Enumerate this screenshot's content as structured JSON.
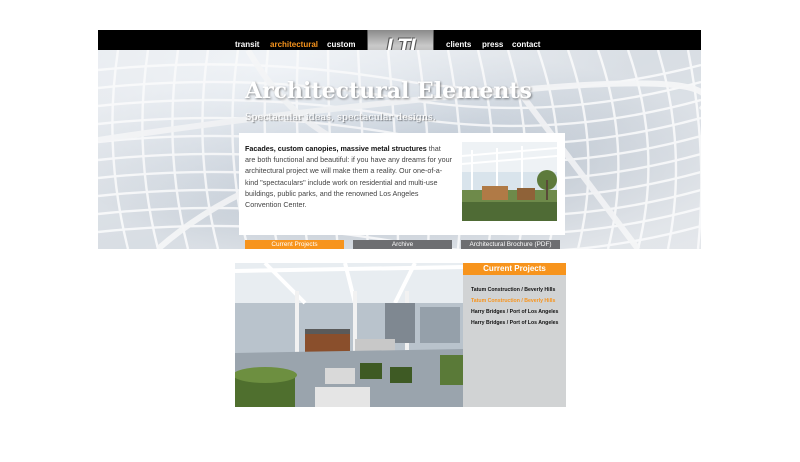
{
  "nav": {
    "left": [
      "transit",
      "architectural",
      "custom"
    ],
    "right": [
      "clients",
      "press",
      "contact"
    ],
    "active": "architectural",
    "logo_text": "LTI"
  },
  "hero": {
    "title": "Architectural Elements",
    "subtitle": "Spectacular ideas, spectacular designs."
  },
  "intro": {
    "lead": "Facades, custom canopies, massive metal structures",
    "body": " that are both functional and beautiful: if you have any dreams for your architectural project we will make them a reality. Our one-of-a-kind \"spectaculars\" include work on residential and multi-use buildings, public parks, and the renowned Los Angeles Convention Center."
  },
  "buttons": {
    "current_projects": "Current Projects",
    "archive": "Archive",
    "brochure": "Architectural Brochure (PDF)"
  },
  "sidebar": {
    "title": "Current Projects",
    "projects": [
      "Tatum Construction / Beverly Hills",
      "Tatum Construction / Beverly Hills",
      "Harry Bridges / Port of Los Angeles",
      "Harry Bridges / Port of Los Angeles"
    ],
    "active_index": 1
  },
  "colors": {
    "accent": "#f7941d",
    "button_gray": "#6d6e71",
    "nav_bg": "#000000",
    "sidebar_bg": "#d1d3d4"
  }
}
